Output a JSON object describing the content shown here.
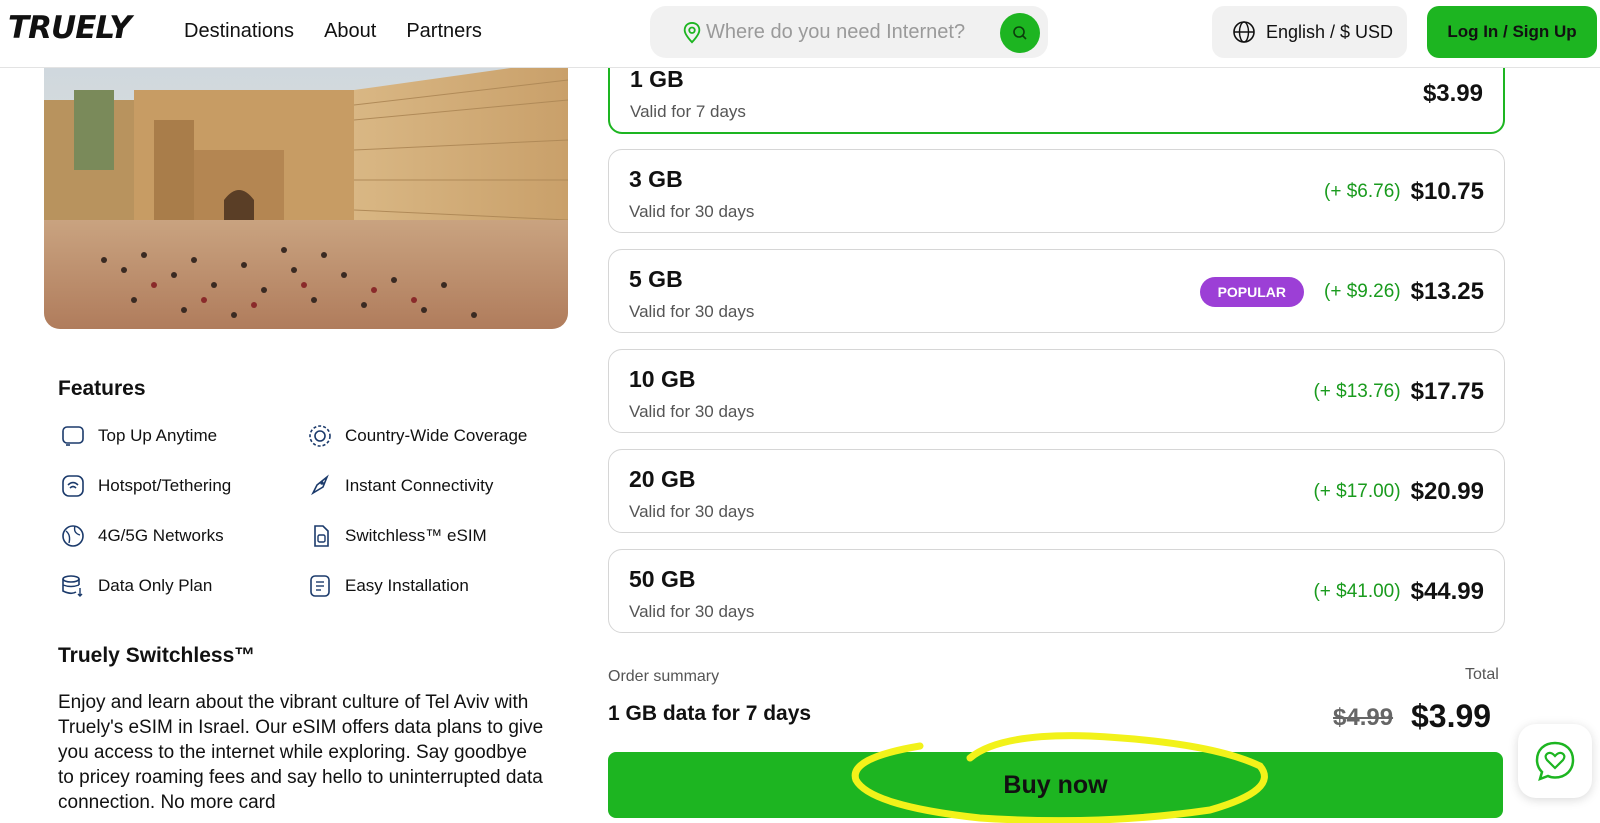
{
  "header": {
    "logo": "TRUELY",
    "nav": [
      "Destinations",
      "About",
      "Partners"
    ],
    "search_placeholder": "Where do you need Internet?",
    "language": "English / $ USD",
    "login": "Log In / Sign Up"
  },
  "features": {
    "title": "Features",
    "items": [
      {
        "label": "Top Up Anytime",
        "icon": "top-up-icon"
      },
      {
        "label": "Country-Wide Coverage",
        "icon": "coverage-icon"
      },
      {
        "label": "Hotspot/Tethering",
        "icon": "hotspot-icon"
      },
      {
        "label": "Instant Connectivity",
        "icon": "rocket-icon"
      },
      {
        "label": "4G/5G Networks",
        "icon": "globe-icon"
      },
      {
        "label": "Switchless™ eSIM",
        "icon": "esim-icon"
      },
      {
        "label": "Data Only Plan",
        "icon": "database-icon"
      },
      {
        "label": "Easy Installation",
        "icon": "document-icon"
      }
    ]
  },
  "switchless": {
    "title": "Truely Switchless™",
    "body": "Enjoy and learn about the vibrant culture of Tel Aviv with Truely's eSIM in Israel. Our eSIM offers data plans to give you access to the internet while exploring. Say goodbye to pricey roaming fees and say hello to uninterrupted data connection. No more card"
  },
  "plans": [
    {
      "gb": "1 GB",
      "valid": "Valid for 7 days",
      "diff": "",
      "price": "$3.99",
      "selected": true
    },
    {
      "gb": "3 GB",
      "valid": "Valid for 30 days",
      "diff": "(+ $6.76)",
      "price": "$10.75"
    },
    {
      "gb": "5 GB",
      "valid": "Valid for 30 days",
      "diff": "(+ $9.26)",
      "price": "$13.25",
      "badge": "POPULAR"
    },
    {
      "gb": "10 GB",
      "valid": "Valid for 30 days",
      "diff": "(+ $13.76)",
      "price": "$17.75"
    },
    {
      "gb": "20 GB",
      "valid": "Valid for 30 days",
      "diff": "(+ $17.00)",
      "price": "$20.99"
    },
    {
      "gb": "50 GB",
      "valid": "Valid for 30 days",
      "diff": "(+ $41.00)",
      "price": "$44.99"
    }
  ],
  "summary": {
    "label": "Order summary",
    "total_label": "Total",
    "description": "1 GB data for 7 days",
    "old_price": "$4.99",
    "price": "$3.99",
    "buy": "Buy now"
  },
  "colors": {
    "accent": "#1db521",
    "popular": "#9c3fd6",
    "highlight": "#f2f21a"
  }
}
